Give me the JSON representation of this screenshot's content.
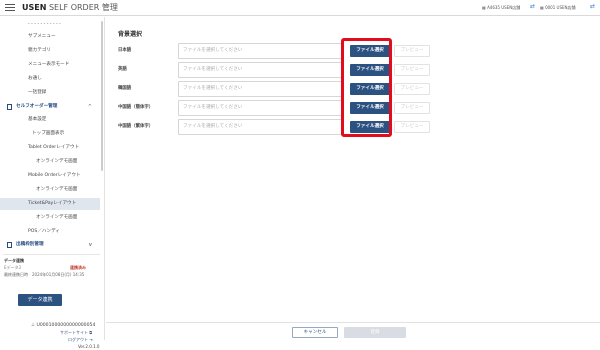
{
  "header": {
    "brand_bold": "USEN",
    "brand_rest": " SELF ORDER 管理",
    "store_info": "A4635 USEN店舗 ",
    "user_info": "0001 USEN店舗 "
  },
  "sidebar": {
    "items": [
      {
        "label": "- - - - - - -  - - - -",
        "level": "l1"
      },
      {
        "label": "サブメニュー",
        "level": "l1"
      },
      {
        "label": "親カテゴリ",
        "level": "l1"
      },
      {
        "label": "メニュー表示モード",
        "level": "l1"
      },
      {
        "label": "お通し",
        "level": "l1"
      },
      {
        "label": "一括登録",
        "level": "l1"
      },
      {
        "label": "セルフオーダー管理",
        "level": "section"
      },
      {
        "label": "基本設定",
        "level": "l1"
      },
      {
        "label": "トップ画面表示",
        "level": "l2"
      },
      {
        "label": "Tablet Orderレイアウト",
        "level": "l1"
      },
      {
        "label": "オンラインデモ画面",
        "level": "l3"
      },
      {
        "label": "Mobile Orderレイアウト",
        "level": "l1"
      },
      {
        "label": "オンラインデモ画面",
        "level": "l3"
      },
      {
        "label": "Ticket&Payレイアウト",
        "level": "l1",
        "active": true
      },
      {
        "label": "オンラインデモ画面",
        "level": "l3"
      },
      {
        "label": "POS／ハンディ",
        "level": "l1"
      },
      {
        "label": "出稿枠別管理",
        "level": "section"
      }
    ],
    "sync": {
      "title": "データ連携",
      "count_label": "Eデータ3",
      "status": "連携済み",
      "last_label": "最終連携日時",
      "last_value": "2024年01月08日(月) 14:35",
      "button": "データ連携"
    },
    "footer": {
      "account": "U0001000000000000054",
      "support": "サポートサイト",
      "logout": "ログアウト",
      "version": "Ver.2.0.1.0"
    }
  },
  "main": {
    "title": "背景選択",
    "placeholder": "ファイルを選択してください",
    "file_button": "ファイル選択",
    "preview_button": "プレビュー",
    "rows": [
      {
        "label": "日本語"
      },
      {
        "label": "英語"
      },
      {
        "label": "韓国語"
      },
      {
        "label": "中国語（簡体字）"
      },
      {
        "label": "中国語（繁体字）"
      }
    ]
  },
  "footer_bar": {
    "cancel": "キャンセル",
    "save": "登録"
  },
  "colors": {
    "accent": "#2c5282",
    "highlight": "#e10d1d"
  }
}
